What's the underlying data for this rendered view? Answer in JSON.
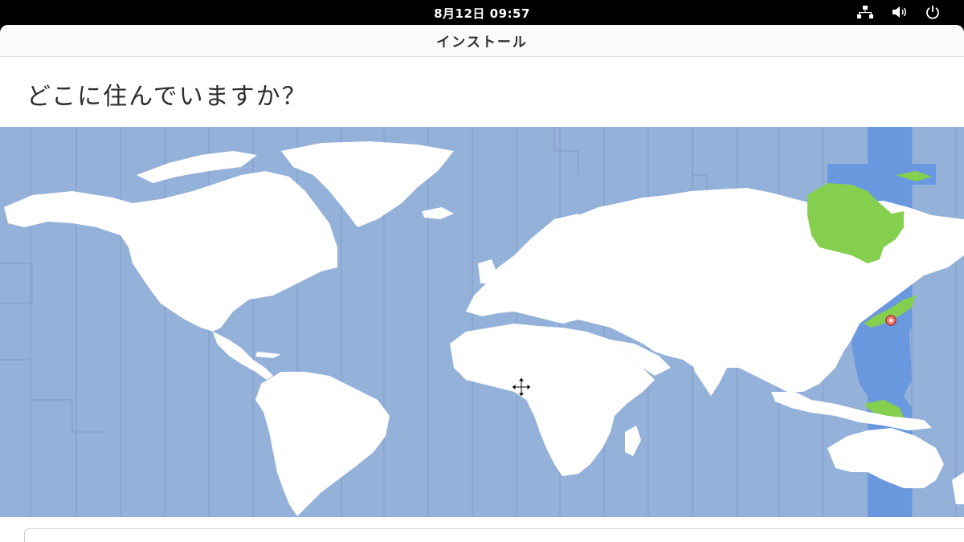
{
  "topbar": {
    "clock": "8月12日  09:57",
    "icons": [
      "network-icon",
      "volume-icon",
      "power-icon"
    ]
  },
  "window": {
    "title": "インストール"
  },
  "page": {
    "question": "どこに住んでいますか？"
  },
  "map": {
    "selected_timezone_band_color": "#6a98de",
    "ocean_color": "#94b1da",
    "land_color": "#ffffff",
    "highlight_land_color": "#84cf4d",
    "pin": "location-pin-icon",
    "cursor": "move-cursor-icon"
  },
  "search": {
    "value": ""
  }
}
